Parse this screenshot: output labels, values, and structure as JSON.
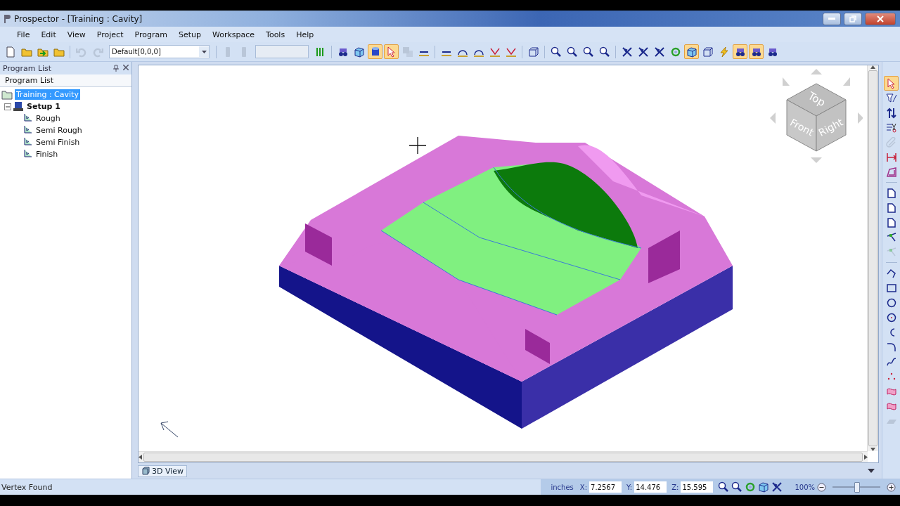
{
  "window": {
    "title": "Prospector - [Training : Cavity]"
  },
  "menu": [
    "File",
    "Edit",
    "View",
    "Project",
    "Program",
    "Setup",
    "Workspace",
    "Tools",
    "Help"
  ],
  "toolbar": {
    "combo_value": "Default[0,0,0]",
    "groups_left": [
      [
        {
          "kind": "new-file",
          "selected": false,
          "disabled": false
        },
        {
          "kind": "folder",
          "selected": false,
          "disabled": false
        },
        {
          "kind": "import",
          "selected": false,
          "disabled": false
        },
        {
          "kind": "folder",
          "selected": false,
          "disabled": false
        }
      ],
      [
        {
          "kind": "undo",
          "selected": false,
          "disabled": true
        },
        {
          "kind": "redo",
          "selected": false,
          "disabled": true
        }
      ]
    ],
    "groups_right": [
      [
        {
          "kind": "bar",
          "selected": false,
          "disabled": true
        },
        {
          "kind": "bar",
          "selected": false,
          "disabled": true
        }
      ],
      [
        {
          "kind": "bars",
          "selected": false,
          "disabled": false
        }
      ],
      [
        {
          "kind": "binoculars",
          "selected": false,
          "disabled": false
        },
        {
          "kind": "cube-select",
          "selected": false,
          "disabled": false
        },
        {
          "kind": "cylinder",
          "selected": true,
          "disabled": false
        },
        {
          "kind": "cursor",
          "selected": true,
          "disabled": false
        },
        {
          "kind": "squares",
          "selected": false,
          "disabled": true
        },
        {
          "kind": "line",
          "selected": false,
          "disabled": false
        }
      ],
      [
        {
          "kind": "line",
          "selected": false,
          "disabled": false
        },
        {
          "kind": "arc",
          "selected": false,
          "disabled": false
        },
        {
          "kind": "arc",
          "selected": false,
          "disabled": false
        },
        {
          "kind": "chevron",
          "selected": false,
          "disabled": false
        },
        {
          "kind": "chevron",
          "selected": false,
          "disabled": false
        }
      ],
      [
        {
          "kind": "wire-cube",
          "selected": false,
          "disabled": false
        }
      ],
      [
        {
          "kind": "zoom",
          "selected": false,
          "disabled": false
        },
        {
          "kind": "zoom",
          "selected": false,
          "disabled": false
        },
        {
          "kind": "zoom",
          "selected": false,
          "disabled": false
        },
        {
          "kind": "zoom",
          "selected": false,
          "disabled": false
        }
      ],
      [
        {
          "kind": "tool",
          "selected": false,
          "disabled": false
        },
        {
          "kind": "tool",
          "selected": false,
          "disabled": false
        },
        {
          "kind": "tool",
          "selected": false,
          "disabled": false
        },
        {
          "kind": "rotate",
          "selected": false,
          "disabled": false
        },
        {
          "kind": "cube",
          "selected": true,
          "disabled": false
        },
        {
          "kind": "wire-cube",
          "selected": false,
          "disabled": false
        },
        {
          "kind": "lightning",
          "selected": false,
          "disabled": false
        },
        {
          "kind": "binoculars",
          "selected": true,
          "disabled": false
        },
        {
          "kind": "binoculars",
          "selected": true,
          "disabled": false
        },
        {
          "kind": "binoculars",
          "selected": false,
          "disabled": false
        }
      ]
    ]
  },
  "program_list": {
    "title": "Program List",
    "header": "Program List",
    "tree": [
      {
        "label": "Training : Cavity",
        "selected": true,
        "children": [
          {
            "label": "Setup 1",
            "selected": false,
            "expanded": true,
            "children": [
              {
                "label": "Rough",
                "selected": false
              },
              {
                "label": "Semi Rough",
                "selected": false
              },
              {
                "label": "Semi Finish",
                "selected": false
              },
              {
                "label": "Finish",
                "selected": false
              }
            ]
          }
        ]
      }
    ]
  },
  "view_cube": {
    "faces": [
      "Top",
      "Front",
      "Right"
    ]
  },
  "side_toolbar": [
    [
      {
        "kind": "cursor",
        "selected": true,
        "disabled": false
      },
      {
        "kind": "filter",
        "selected": false,
        "disabled": false
      },
      {
        "kind": "updown",
        "selected": false,
        "disabled": false
      },
      {
        "kind": "scissors",
        "selected": false,
        "disabled": false
      },
      {
        "kind": "clip",
        "selected": false,
        "disabled": true
      },
      {
        "kind": "dimension",
        "selected": false,
        "disabled": false
      },
      {
        "kind": "trapezoid",
        "selected": false,
        "disabled": false
      }
    ],
    [
      {
        "kind": "page",
        "selected": false,
        "disabled": false
      },
      {
        "kind": "page",
        "selected": false,
        "disabled": false
      },
      {
        "kind": "page",
        "selected": false,
        "disabled": false
      },
      {
        "kind": "node",
        "selected": false,
        "disabled": false
      },
      {
        "kind": "node",
        "selected": false,
        "disabled": true
      }
    ],
    [
      {
        "kind": "polyline",
        "selected": false,
        "disabled": false
      },
      {
        "kind": "rectangle",
        "selected": false,
        "disabled": false
      },
      {
        "kind": "circle",
        "selected": false,
        "disabled": false
      },
      {
        "kind": "circle-dot",
        "selected": false,
        "disabled": false
      },
      {
        "kind": "arc-c",
        "selected": false,
        "disabled": false
      },
      {
        "kind": "fillet",
        "selected": false,
        "disabled": false
      },
      {
        "kind": "spline",
        "selected": false,
        "disabled": false
      },
      {
        "kind": "points",
        "selected": false,
        "disabled": false
      },
      {
        "kind": "surface",
        "selected": false,
        "disabled": false
      },
      {
        "kind": "surface",
        "selected": false,
        "disabled": false
      },
      {
        "kind": "plane",
        "selected": false,
        "disabled": true
      }
    ]
  ],
  "view_tabs": [
    {
      "label": "3D View",
      "selected": true
    }
  ],
  "status_bar": {
    "message": "Vertex Found",
    "units": "inches",
    "coords": [
      {
        "axis": "X:",
        "value": "7.2567"
      },
      {
        "axis": "Y:",
        "value": "14.476"
      },
      {
        "axis": "Z:",
        "value": "15.595"
      }
    ],
    "zoom": "100%",
    "zoom_slider": {
      "level": 0.5
    }
  }
}
